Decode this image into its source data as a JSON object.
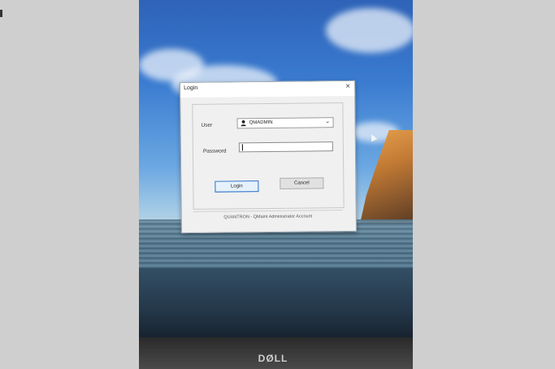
{
  "dialog": {
    "title": "Login",
    "close_label": "×",
    "user_label": "User",
    "user_value": "QMADMIN",
    "password_label": "Password",
    "password_value": "",
    "login_button": "Login",
    "cancel_button": "Cancel",
    "status_text": "QUANTRON - QMaint Administrator Account"
  },
  "device": {
    "brand": "DØLL"
  },
  "icons": {
    "user": "user-avatar-icon",
    "dropdown": "chevron-down-icon",
    "close": "close-icon",
    "cursor": "mouse-pointer-icon"
  },
  "colors": {
    "focus_border": "#2a6fc9",
    "dialog_bg": "#f0f0f0"
  }
}
